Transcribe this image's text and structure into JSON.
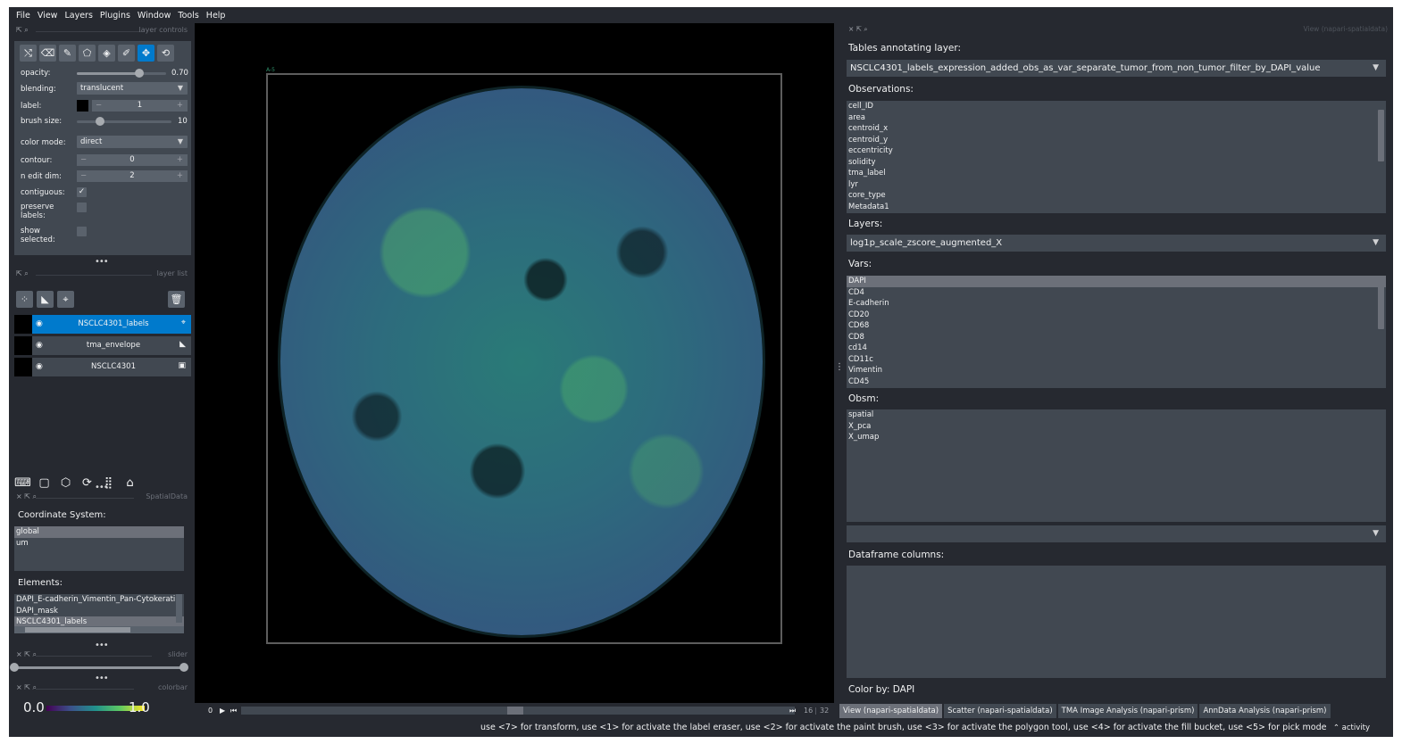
{
  "menu": [
    "File",
    "View",
    "Layers",
    "Plugins",
    "Window",
    "Tools",
    "Help"
  ],
  "layer_controls": {
    "dock_title": "layer controls",
    "tools": [
      "shuffle-icon",
      "eraser-icon",
      "paint-brush-icon",
      "polygon-icon",
      "fill-bucket-icon",
      "color-picker-icon",
      "move-icon",
      "transform-icon"
    ],
    "opacity_label": "opacity:",
    "opacity_value": "0.70",
    "opacity_level": 0.7,
    "blending_label": "blending:",
    "blending_value": "translucent",
    "label_label": "label:",
    "label_value": "1",
    "brush_label": "brush size:",
    "brush_value": "10",
    "color_mode_label": "color mode:",
    "color_mode_value": "direct",
    "contour_label": "contour:",
    "contour_value": "0",
    "n_edit_label": "n edit dim:",
    "n_edit_value": "2",
    "contiguous_label": "contiguous:",
    "preserve_label": "preserve labels:",
    "show_selected_label": "show selected:"
  },
  "layer_list": {
    "dock_title": "layer list",
    "layers": [
      {
        "name": "NSCLC4301_labels",
        "type_icon": "label-icon",
        "selected": true
      },
      {
        "name": "tma_envelope",
        "type_icon": "shapes-icon",
        "selected": false
      },
      {
        "name": "NSCLC4301",
        "type_icon": "image-icon",
        "selected": false
      }
    ]
  },
  "spatialdata": {
    "dock_title": "SpatialData",
    "coord_label": "Coordinate System:",
    "coord_items": [
      "global",
      "um"
    ],
    "coord_selected": "global",
    "elements_label": "Elements:",
    "elements": [
      "DAPI_E-cadherin_Vimentin_Pan-Cytokerati",
      "DAPI_mask",
      "NSCLC4301_labels"
    ],
    "elements_selected": "NSCLC4301_labels"
  },
  "slider": {
    "dock_title": "slider"
  },
  "colorbar": {
    "dock_title": "colorbar",
    "min": "0.0",
    "max": "1.0"
  },
  "canvas": {
    "frame_label": "A-5"
  },
  "dims": {
    "current": "0",
    "value": "16",
    "total": "32"
  },
  "right_panel": {
    "dock_title": "View (napari-spatialdata)",
    "tables_label": "Tables annotating layer:",
    "table_value": "NSCLC4301_labels_expression_added_obs_as_var_separate_tumor_from_non_tumor_filter_by_DAPI_value",
    "obs_label": "Observations:",
    "obs": [
      "cell_ID",
      "area",
      "centroid_x",
      "centroid_y",
      "eccentricity",
      "solidity",
      "tma_label",
      "lyr",
      "core_type",
      "Metadata1"
    ],
    "layers_label": "Layers:",
    "layers_value": "log1p_scale_zscore_augmented_X",
    "vars_label": "Vars:",
    "vars": [
      "DAPI",
      "CD4",
      "E-cadherin",
      "CD20",
      "CD68",
      "CD8",
      "cd14",
      "CD11c",
      "Vimentin",
      "CD45"
    ],
    "vars_selected": "DAPI",
    "obsm_label": "Obsm:",
    "obsm": [
      "spatial",
      "X_pca",
      "X_umap"
    ],
    "df_label": "Dataframe columns:",
    "color_by": "Color by: DAPI"
  },
  "tabs": [
    {
      "label": "View (napari-spatialdata)",
      "active": true
    },
    {
      "label": "Scatter (napari-spatialdata)",
      "active": false
    },
    {
      "label": "TMA Image Analysis (napari-prism)",
      "active": false
    },
    {
      "label": "AnnData Analysis (napari-prism)",
      "active": false
    }
  ],
  "status": {
    "message": "use <7> for transform, use <1> for activate the label eraser, use <2> for activate the paint brush, use <3> for activate the polygon tool, use <4> for activate the fill bucket, use <5> for pick mode",
    "activity": "activity"
  }
}
